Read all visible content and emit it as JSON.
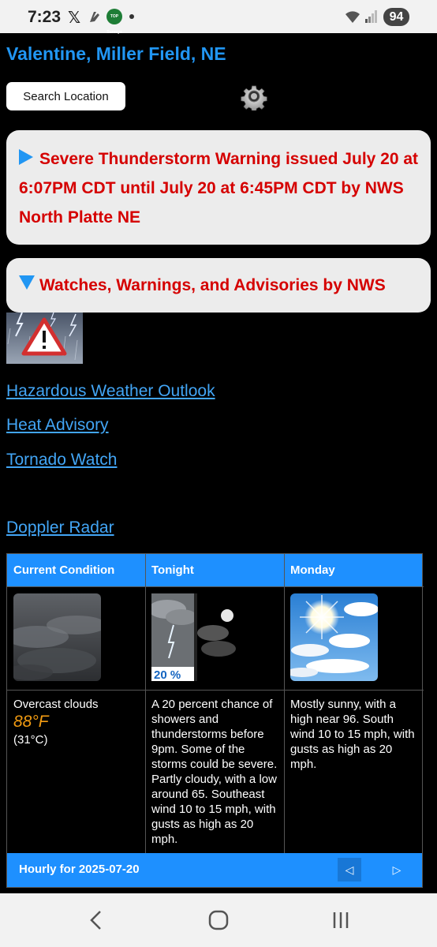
{
  "status_bar": {
    "time": "7:23",
    "x_app": "𝕏",
    "top_badge": "TOP Surveys",
    "battery": "94"
  },
  "header": {
    "location": "Valentine, Miller Field, NE",
    "search_label": "Search Location"
  },
  "alerts": {
    "severe_warning": "Severe Thunderstorm Warning issued July 20 at 6:07PM CDT until July 20 at 6:45PM CDT by NWS North Platte NE",
    "watches_title": "Watches, Warnings, and Advisories by NWS"
  },
  "links": {
    "hazardous": "Hazardous Weather Outlook",
    "heat": "Heat Advisory",
    "tornado": "Tornado Watch",
    "radar": "Doppler Radar"
  },
  "forecast": {
    "current": {
      "header": "Current Condition",
      "desc": "Overcast clouds",
      "temp_f": "88°F",
      "temp_c": "(31°C)"
    },
    "tonight": {
      "header": "Tonight",
      "pop": "20 %",
      "desc": "A 20 percent chance of showers and thunderstorms before 9pm. Some of the storms could be severe. Partly cloudy, with a low around 65. Southeast wind 10 to 15 mph, with gusts as high as 20 mph."
    },
    "monday": {
      "header": "Monday",
      "desc": "Mostly sunny, with a high near 96. South wind 10 to 15 mph, with gusts as high as 20 mph."
    }
  },
  "hourly": {
    "title": "Hourly for 2025-07-20",
    "prev": "◁",
    "next": "▷"
  },
  "colors": {
    "accent": "#2196f3",
    "alert_red": "#d50000",
    "temp_orange": "#f39c12"
  }
}
